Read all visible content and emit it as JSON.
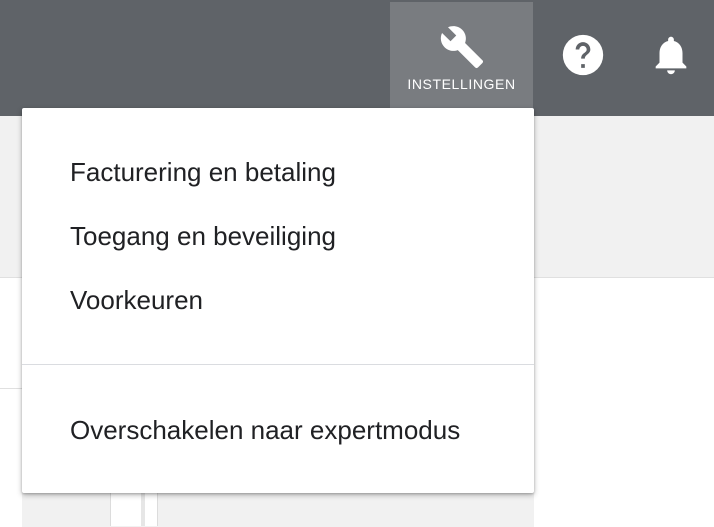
{
  "header": {
    "settings_label": "INSTELLINGEN",
    "settings_icon": "wrench-icon",
    "help_icon": "help-icon",
    "notifications_icon": "bell-icon",
    "colors": {
      "bar": "#5f6368",
      "active_button": "#797c80",
      "icon": "#ffffff"
    }
  },
  "menu": {
    "items": [
      {
        "label": "Facturering en betaling"
      },
      {
        "label": "Toegang en beveiliging"
      },
      {
        "label": "Voorkeuren"
      },
      {
        "label": "Overschakelen naar expertmodus"
      }
    ]
  }
}
